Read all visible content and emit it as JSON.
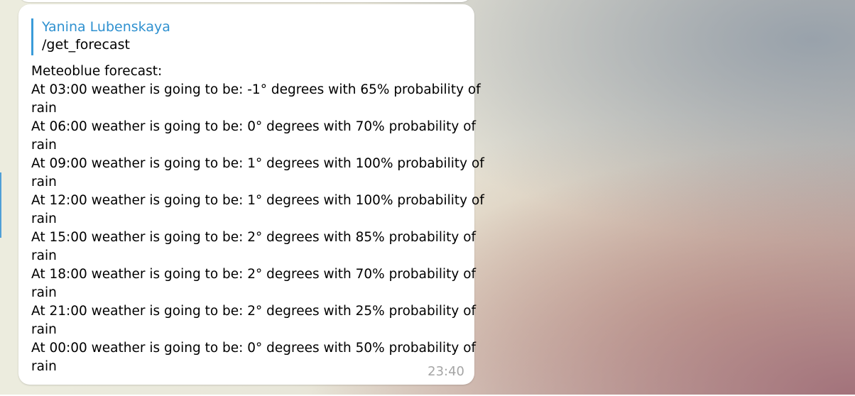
{
  "reply": {
    "author": "Yanina Lubenskaya",
    "text": "/get_forecast"
  },
  "message": {
    "lines": [
      "Meteoblue forecast:",
      "At 03:00 weather is going to be: -1° degrees with 65% probability of",
      "rain",
      "At 06:00 weather is going to be: 0° degrees with 70% probability of",
      "rain",
      "At 09:00 weather is going to be: 1° degrees with 100% probability of",
      "rain",
      "At 12:00 weather is going to be: 1° degrees with 100% probability of",
      "rain",
      "At 15:00 weather is going to be: 2° degrees with 85% probability of",
      "rain",
      "At 18:00 weather is going to be: 2° degrees with 70% probability of",
      "rain",
      "At 21:00 weather is going to be: 2° degrees with 25% probability of",
      "rain",
      "At 00:00 weather is going to be: 0° degrees with 50% probability of",
      "rain"
    ],
    "time": "23:40"
  },
  "colors": {
    "link_blue": "#2f91d0",
    "time_gray": "#a5a5a5",
    "bubble_bg": "#ffffff"
  }
}
